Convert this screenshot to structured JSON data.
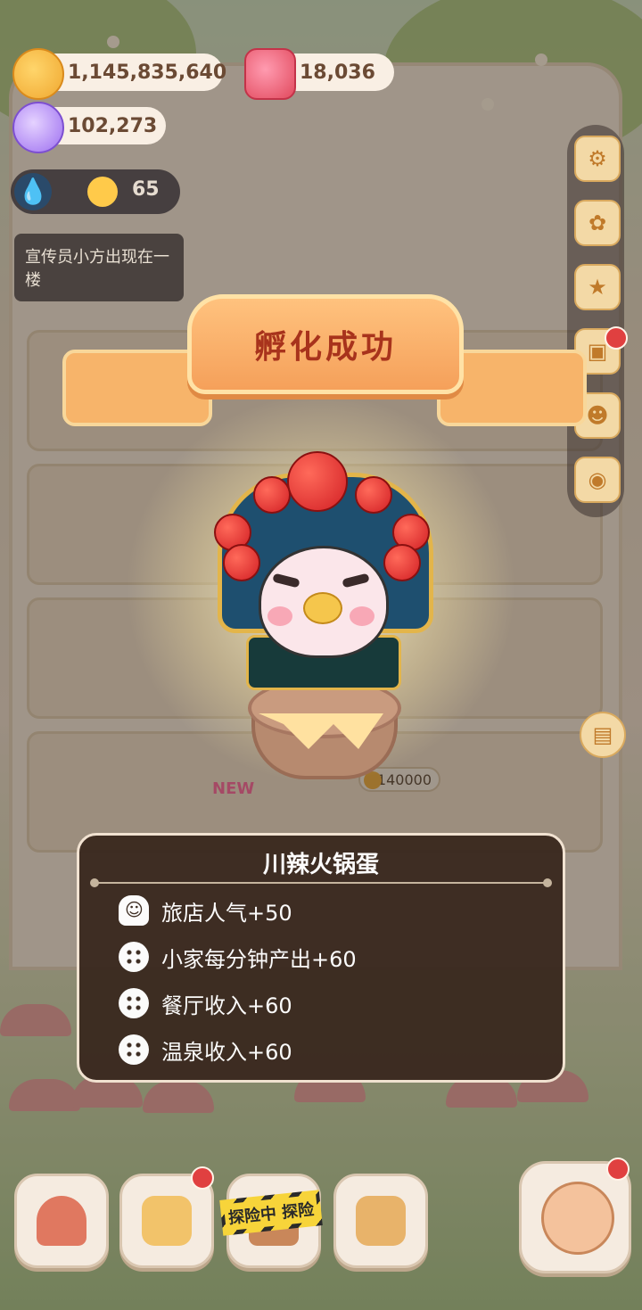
{
  "currencies": {
    "coins": "1,145,835,640",
    "gems": "18,036",
    "crystals": "102,273"
  },
  "water": {
    "value": "65"
  },
  "notice": {
    "text": "宣传员小方出现在一楼"
  },
  "banner": {
    "title": "孵化成功"
  },
  "pet": {
    "name": "川辣火锅蛋",
    "stats": [
      {
        "icon": "chef-icon",
        "text": "旅店人气+50"
      },
      {
        "icon": "cookie-icon",
        "text": "小家每分钟产出+60"
      },
      {
        "icon": "cookie-icon",
        "text": "餐厅收入+60"
      },
      {
        "icon": "cookie-icon",
        "text": "温泉收入+60"
      }
    ]
  },
  "scene": {
    "price_tag": "140000",
    "new_tag": "NEW"
  },
  "bottom_bar": {
    "explore_label": "探险中 探险"
  },
  "colors": {
    "banner": "#f5a05a",
    "banner_text": "#a8331c",
    "panel_bg": "#3b2a20",
    "badge_red": "#e04040"
  }
}
